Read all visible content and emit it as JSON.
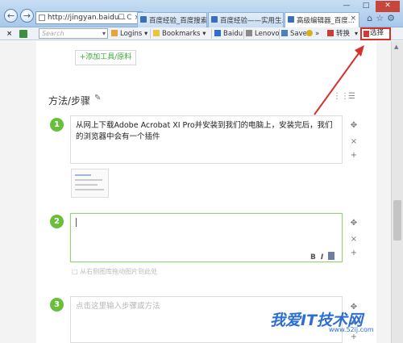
{
  "browser": {
    "address": "http://jingyan.baidu...",
    "address_tools": "☐ C ×",
    "tabs": [
      {
        "label": "百度经验_百度搜索"
      },
      {
        "label": "百度经验——实用生..."
      },
      {
        "label": "高级编辑器_百度..."
      }
    ],
    "window_controls": {
      "minimize": "—",
      "maximize": "□",
      "close": "✕"
    },
    "chrome_icons": "⌂☆⚙"
  },
  "toolbar": {
    "close_label": "×",
    "search_placeholder": "Search",
    "search_arrow": "▾",
    "logins_label": "Logins ▾",
    "bookmarks_label": "Bookmarks ▾",
    "baidu_label": "Baidu",
    "lenovo_label": "Lenovo",
    "save_label": "Save",
    "more_label": "»",
    "switch_label": "转换",
    "switch_arrow": "▾",
    "select_label": "选择"
  },
  "page": {
    "add_tool_label": "+添加工具/原料",
    "section_title": "方法/步骤",
    "steps": [
      {
        "number": "1",
        "text": "从网上下载Adobe Acrobat XI Pro并安装到我们的电脑上，安装完后，我们的浏览器中会有一个插件"
      },
      {
        "number": "2",
        "text": ""
      },
      {
        "number": "3",
        "placeholder": "点击这里输入步骤或方法"
      }
    ],
    "editor_bold": "B",
    "editor_italic": "I",
    "image_hint": "从右侧图库拖动图片到此处",
    "move_icon": "✥",
    "delete_icon": "×",
    "add_icon": "+"
  },
  "watermark": {
    "text": "我爱IT技术网",
    "url": "www.52ij.com"
  },
  "colors": {
    "accent_green": "#6abf3a",
    "highlight_red": "#d9302c",
    "watermark_blue": "#2c6fd1"
  }
}
